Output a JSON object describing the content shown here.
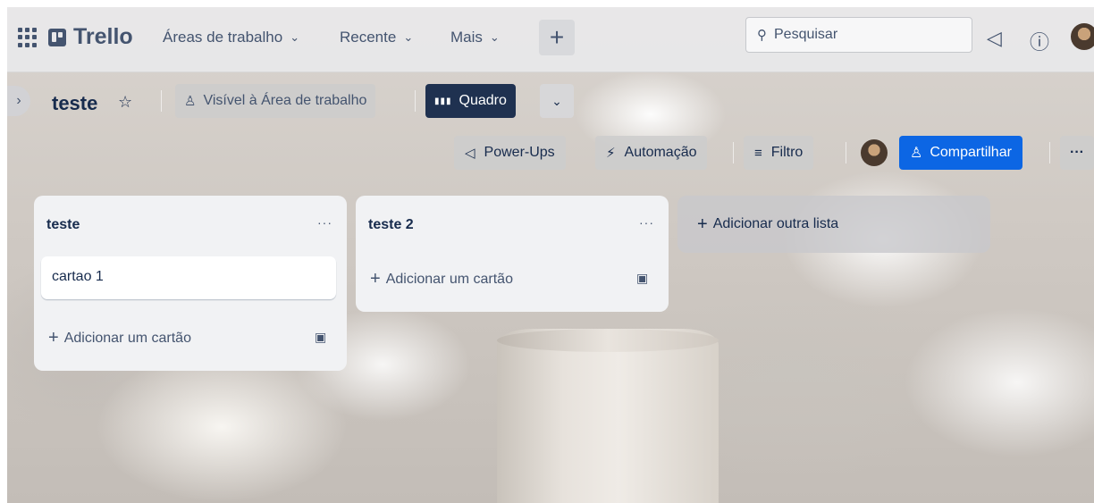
{
  "header": {
    "logo_text": "Trello",
    "menus": [
      {
        "label": "Áreas de trabalho"
      },
      {
        "label": "Recente"
      },
      {
        "label": "Mais"
      }
    ],
    "create_label": "+",
    "search_placeholder": "Pesquisar",
    "icons": [
      "apps-grid-icon",
      "megaphone-icon",
      "help-icon",
      "avatar"
    ]
  },
  "board_bar": {
    "title": "teste",
    "visibility_label": "Visível à Área de trabalho",
    "view_label": "Quadro",
    "powerups_label": "Power-Ups",
    "automation_label": "Automação",
    "filter_label": "Filtro",
    "share_label": "Compartilhar",
    "more_label": "···"
  },
  "lists": [
    {
      "title": "teste",
      "menu": "···",
      "cards": [
        {
          "title": "cartao 1"
        }
      ],
      "add_card_label": "Adicionar um cartão"
    },
    {
      "title": "teste 2",
      "menu": "···",
      "cards": [],
      "add_card_label": "Adicionar um cartão"
    }
  ],
  "add_list_label": "Adicionar outra lista",
  "colors": {
    "header_bg": "#e8e8ea",
    "text_primary": "#172b4d",
    "text_secondary": "#44546f",
    "board_button_bg": "#1f3150",
    "share_button_bg": "#0c66e4",
    "list_bg": "#f1f2f4"
  }
}
